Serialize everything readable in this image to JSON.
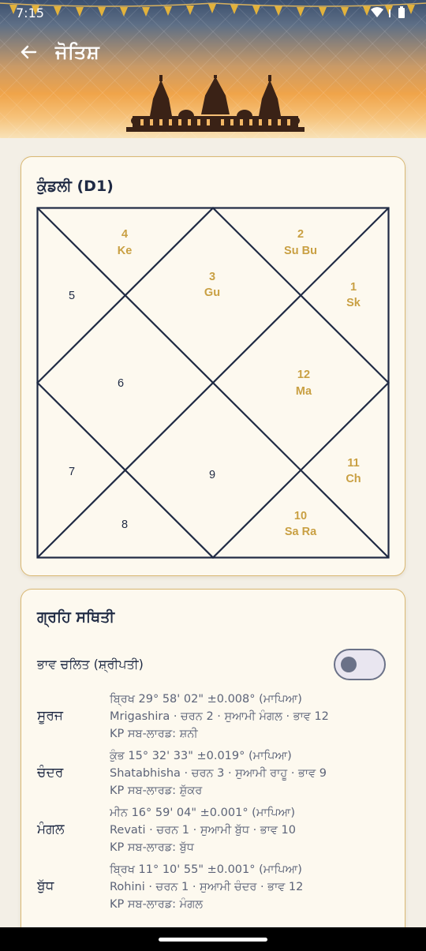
{
  "status_bar": {
    "time": "7:15"
  },
  "header": {
    "title": "ਜੋਤਿਸ਼",
    "back_icon": "arrow-left-icon"
  },
  "kundli": {
    "title": "ਕੁੰਡਲੀ (D1)",
    "colors": {
      "line": "#1f2a44",
      "occupied": "#c9a043",
      "empty": "#1f2a44"
    },
    "houses": [
      {
        "sign": "4",
        "planets": "Ke"
      },
      {
        "sign": "2",
        "planets": "Su Bu"
      },
      {
        "sign": "3",
        "planets": "Gu"
      },
      {
        "sign": "5",
        "planets": ""
      },
      {
        "sign": "1",
        "planets": "Sk"
      },
      {
        "sign": "6",
        "planets": ""
      },
      {
        "sign": "12",
        "planets": "Ma"
      },
      {
        "sign": "7",
        "planets": ""
      },
      {
        "sign": "9",
        "planets": ""
      },
      {
        "sign": "11",
        "planets": "Ch"
      },
      {
        "sign": "8",
        "planets": ""
      },
      {
        "sign": "10",
        "planets": "Sa Ra"
      }
    ]
  },
  "graha": {
    "title": "ਗ੍ਰਹਿ ਸਥਿਤੀ",
    "toggle_label": "ਭਾਵ ਚਲਿਤ (ਸ਼੍ਰੀਪਤੀ)",
    "toggle_on": false,
    "planets": [
      {
        "name": "ਸੂਰਜ",
        "line1": "ਬ੍ਰਿਖ 29° 58' 02\"  ±0.008° (ਮਾਪਿਆ)",
        "line2": "Mrigashira · ਚਰਨ 2 · ਸੁਆਮੀ ਮੰਗਲ · ਭਾਵ 12",
        "line3": "KP ਸਬ-ਲਾਰਡ: ਸ਼ਨੀ"
      },
      {
        "name": "ਚੰਦਰ",
        "line1": "ਕੁੰਭ 15° 32' 33\"  ±0.019° (ਮਾਪਿਆ)",
        "line2": "Shatabhisha · ਚਰਨ 3 · ਸੁਆਮੀ ਰਾਹੂ · ਭਾਵ 9",
        "line3": "KP ਸਬ-ਲਾਰਡ: ਸ਼ੁੱਕਰ"
      },
      {
        "name": "ਮੰਗਲ",
        "line1": "ਮੀਨ 16° 59' 04\"  ±0.001° (ਮਾਪਿਆ)",
        "line2": "Revati · ਚਰਨ 1 · ਸੁਆਮੀ ਬੁੱਧ · ਭਾਵ 10",
        "line3": "KP ਸਬ-ਲਾਰਡ: ਬੁੱਧ"
      },
      {
        "name": "ਬੁੱਧ",
        "line1": "ਬ੍ਰਿਖ 11° 10' 55\"  ±0.001° (ਮਾਪਿਆ)",
        "line2": "Rohini · ਚਰਨ 1 · ਸੁਆਮੀ ਚੰਦਰ · ਭਾਵ 12",
        "line3": "KP ਸਬ-ਲਾਰਡ: ਮੰਗਲ"
      }
    ]
  }
}
